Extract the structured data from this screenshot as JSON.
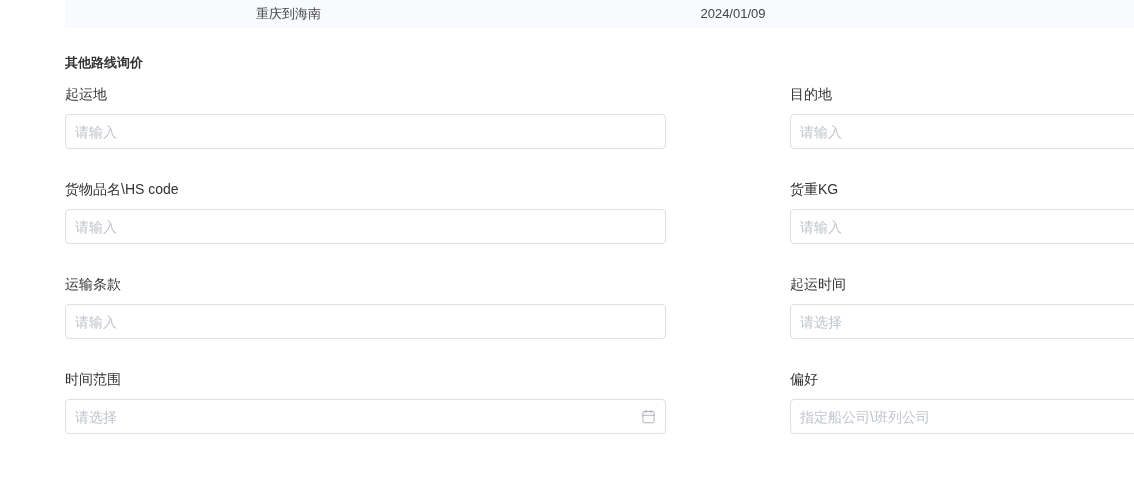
{
  "table_row": {
    "cells": [
      "重庆到海南",
      "2024/01/09"
    ]
  },
  "section": {
    "title": "其他路线询价"
  },
  "fields": [
    {
      "label": "起运地",
      "placeholder": "请输入",
      "kind": "input"
    },
    {
      "label": "目的地",
      "placeholder": "请输入",
      "kind": "input"
    },
    {
      "label": "货物品名\\HS code",
      "placeholder": "请输入",
      "kind": "input"
    },
    {
      "label": "货重KG",
      "placeholder": "请输入",
      "kind": "input"
    },
    {
      "label": "运输条款",
      "placeholder": "请输入",
      "kind": "input"
    },
    {
      "label": "起运时间",
      "placeholder": "请选择",
      "kind": "input"
    },
    {
      "label": "时间范围",
      "placeholder": "请选择",
      "kind": "date"
    },
    {
      "label": "偏好",
      "placeholder": "指定船公司\\班列公司",
      "kind": "input"
    }
  ]
}
